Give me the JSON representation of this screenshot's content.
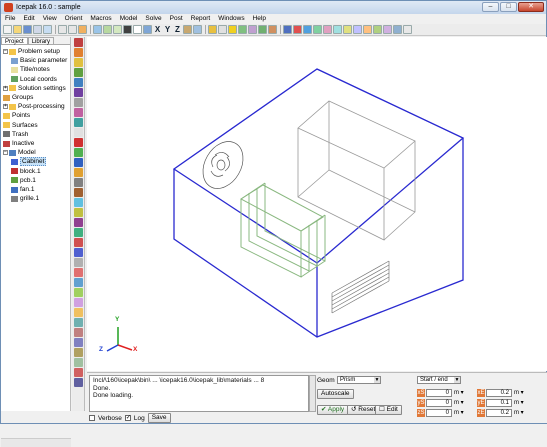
{
  "window": {
    "title": "Icepak 16.0 : sample",
    "minimize": "–",
    "maximize": "□",
    "close": "✕"
  },
  "menu": [
    "File",
    "Edit",
    "View",
    "Orient",
    "Macros",
    "Model",
    "Solve",
    "Post",
    "Report",
    "Windows",
    "Help"
  ],
  "toolbar": {
    "axis_labels": [
      "X",
      "Y",
      "Z"
    ]
  },
  "tabs": [
    "Project",
    "Library"
  ],
  "tree": [
    {
      "label": "Problem setup",
      "level": 0,
      "expander": "−",
      "icon": "folder-icon"
    },
    {
      "label": "Basic parameter",
      "level": 1,
      "icon": "settings-icon"
    },
    {
      "label": "Title/notes",
      "level": 1,
      "icon": "notes-icon"
    },
    {
      "label": "Local coords",
      "level": 1,
      "icon": "coords-icon"
    },
    {
      "label": "Solution settings",
      "level": 0,
      "expander": "+",
      "icon": "folder-icon"
    },
    {
      "label": "Groups",
      "level": 0,
      "icon": "groups-icon"
    },
    {
      "label": "Post-processing",
      "level": 0,
      "expander": "+",
      "icon": "folder-icon"
    },
    {
      "label": "Points",
      "level": 0,
      "icon": "folder-icon"
    },
    {
      "label": "Surfaces",
      "level": 0,
      "icon": "folder-icon"
    },
    {
      "label": "Trash",
      "level": 0,
      "icon": "trash-icon"
    },
    {
      "label": "Inactive",
      "level": 0,
      "icon": "inactive-icon"
    },
    {
      "label": "Model",
      "level": 0,
      "expander": "−",
      "icon": "model-icon"
    },
    {
      "label": "Cabinet",
      "level": 1,
      "icon": "cabinet-icon",
      "selected": true
    },
    {
      "label": "block.1",
      "level": 1,
      "icon": "block-icon"
    },
    {
      "label": "pcb.1",
      "level": 1,
      "icon": "pcb-icon"
    },
    {
      "label": "fan.1",
      "level": 1,
      "icon": "fan-icon"
    },
    {
      "label": "grille.1",
      "level": 1,
      "icon": "grille-icon"
    }
  ],
  "viewport": {
    "axes": {
      "x": "X",
      "y": "Y",
      "z": "Z"
    }
  },
  "console": {
    "lines": [
      "Incl/\\160\\icepak\\bin\\ ... \\icepak16.0\\icepak_lib\\materials ... 8",
      "Done.",
      "Done loading."
    ],
    "verbose_label": "Verbose",
    "log_label": "Log",
    "save_label": "Save",
    "verbose_checked": false,
    "log_checked": true
  },
  "geom": {
    "geom_label": "Geom",
    "geom_value": "Prism",
    "mode_value": "Start / end",
    "autoscale_label": "Autoscale",
    "apply_label": "Apply",
    "reset_label": "Reset",
    "edit_label": "Edit",
    "fields": [
      {
        "axis": "xS",
        "value": "0",
        "unit": "m"
      },
      {
        "axis": "xE",
        "value": "0.2",
        "unit": "m"
      },
      {
        "axis": "yS",
        "value": "0",
        "unit": "m"
      },
      {
        "axis": "yE",
        "value": "0.1",
        "unit": "m"
      },
      {
        "axis": "zS",
        "value": "0",
        "unit": "m"
      },
      {
        "axis": "zE",
        "value": "0.2",
        "unit": "m"
      }
    ]
  }
}
